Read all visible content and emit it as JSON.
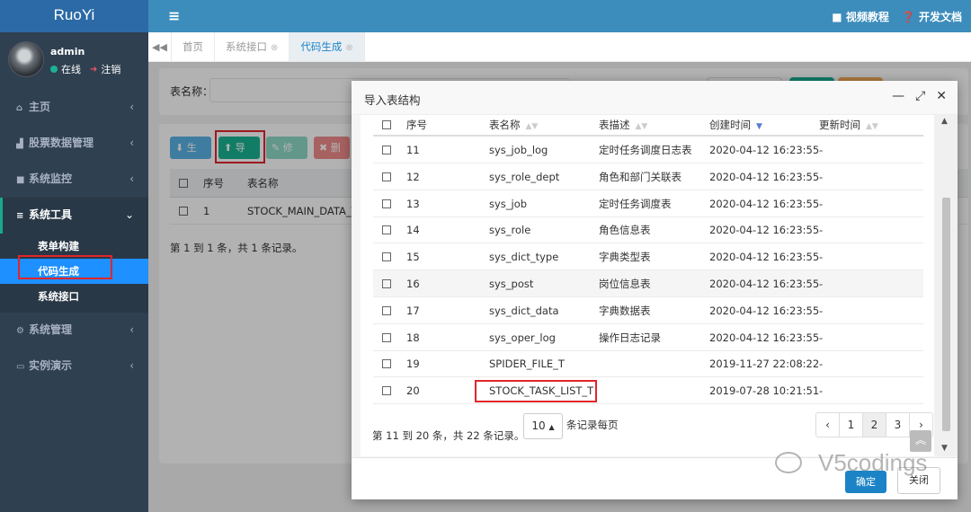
{
  "app": {
    "logo": "RuoYi"
  },
  "user": {
    "name": "admin",
    "status": "在线",
    "logout": "注销"
  },
  "sidebar": {
    "items": [
      {
        "label": "主页",
        "icon": "home-icon"
      },
      {
        "label": "股票数据管理",
        "icon": "chart-icon"
      },
      {
        "label": "系统监控",
        "icon": "video-icon"
      },
      {
        "label": "系统工具",
        "icon": "bars-icon",
        "expanded": true,
        "children": [
          "表单构建",
          "代码生成",
          "系统接口"
        ],
        "active_child": "代码生成"
      },
      {
        "label": "系统管理",
        "icon": "gear-icon"
      },
      {
        "label": "实例演示",
        "icon": "desktop-icon"
      }
    ]
  },
  "header": {
    "menu_icon": "hamburger-icon",
    "links": [
      "视频教程",
      "开发文档"
    ]
  },
  "tabs": [
    {
      "label": "首页",
      "closable": false
    },
    {
      "label": "系统接口",
      "closable": true
    },
    {
      "label": "代码生成",
      "closable": true,
      "active": true
    }
  ],
  "page": {
    "search_label": "表名称：",
    "toolbar": {
      "generate": "生成",
      "import": "导入",
      "modify": "修改",
      "delete": "删除"
    },
    "table": {
      "headers": [
        "序号",
        "表名称"
      ],
      "rows": [
        {
          "no": "1",
          "name": "STOCK_MAIN_DATA_T"
        }
      ]
    },
    "page_info": "第 1 到 1 条，共 1 条记录。"
  },
  "modal": {
    "title": "导入表结构",
    "headers": [
      "序号",
      "表名称",
      "表描述",
      "创建时间",
      "更新时间"
    ],
    "rows": [
      {
        "no": "11",
        "name": "sys_job_log",
        "desc": "定时任务调度日志表",
        "created": "2020-04-12 16:23:55",
        "updated": "-"
      },
      {
        "no": "12",
        "name": "sys_role_dept",
        "desc": "角色和部门关联表",
        "created": "2020-04-12 16:23:55",
        "updated": "-"
      },
      {
        "no": "13",
        "name": "sys_job",
        "desc": "定时任务调度表",
        "created": "2020-04-12 16:23:55",
        "updated": "-"
      },
      {
        "no": "14",
        "name": "sys_role",
        "desc": "角色信息表",
        "created": "2020-04-12 16:23:55",
        "updated": "-"
      },
      {
        "no": "15",
        "name": "sys_dict_type",
        "desc": "字典类型表",
        "created": "2020-04-12 16:23:55",
        "updated": "-"
      },
      {
        "no": "16",
        "name": "sys_post",
        "desc": "岗位信息表",
        "created": "2020-04-12 16:23:55",
        "updated": "-"
      },
      {
        "no": "17",
        "name": "sys_dict_data",
        "desc": "字典数据表",
        "created": "2020-04-12 16:23:55",
        "updated": "-"
      },
      {
        "no": "18",
        "name": "sys_oper_log",
        "desc": "操作日志记录",
        "created": "2020-04-12 16:23:55",
        "updated": "-"
      },
      {
        "no": "19",
        "name": "SPIDER_FILE_T",
        "desc": "",
        "created": "2019-11-27 22:08:22",
        "updated": "-"
      },
      {
        "no": "20",
        "name": "STOCK_TASK_LIST_T",
        "desc": "",
        "created": "2019-07-28 10:21:51",
        "updated": "-"
      }
    ],
    "pager_info": "第 11 到 20 条，共 22 条记录。",
    "page_size": "10",
    "page_size_label": "条记录每页",
    "pages": [
      "‹",
      "1",
      "2",
      "3",
      "›"
    ],
    "current_page": "2",
    "ok": "确定",
    "close": "关闭"
  },
  "watermark": "V5codings"
}
